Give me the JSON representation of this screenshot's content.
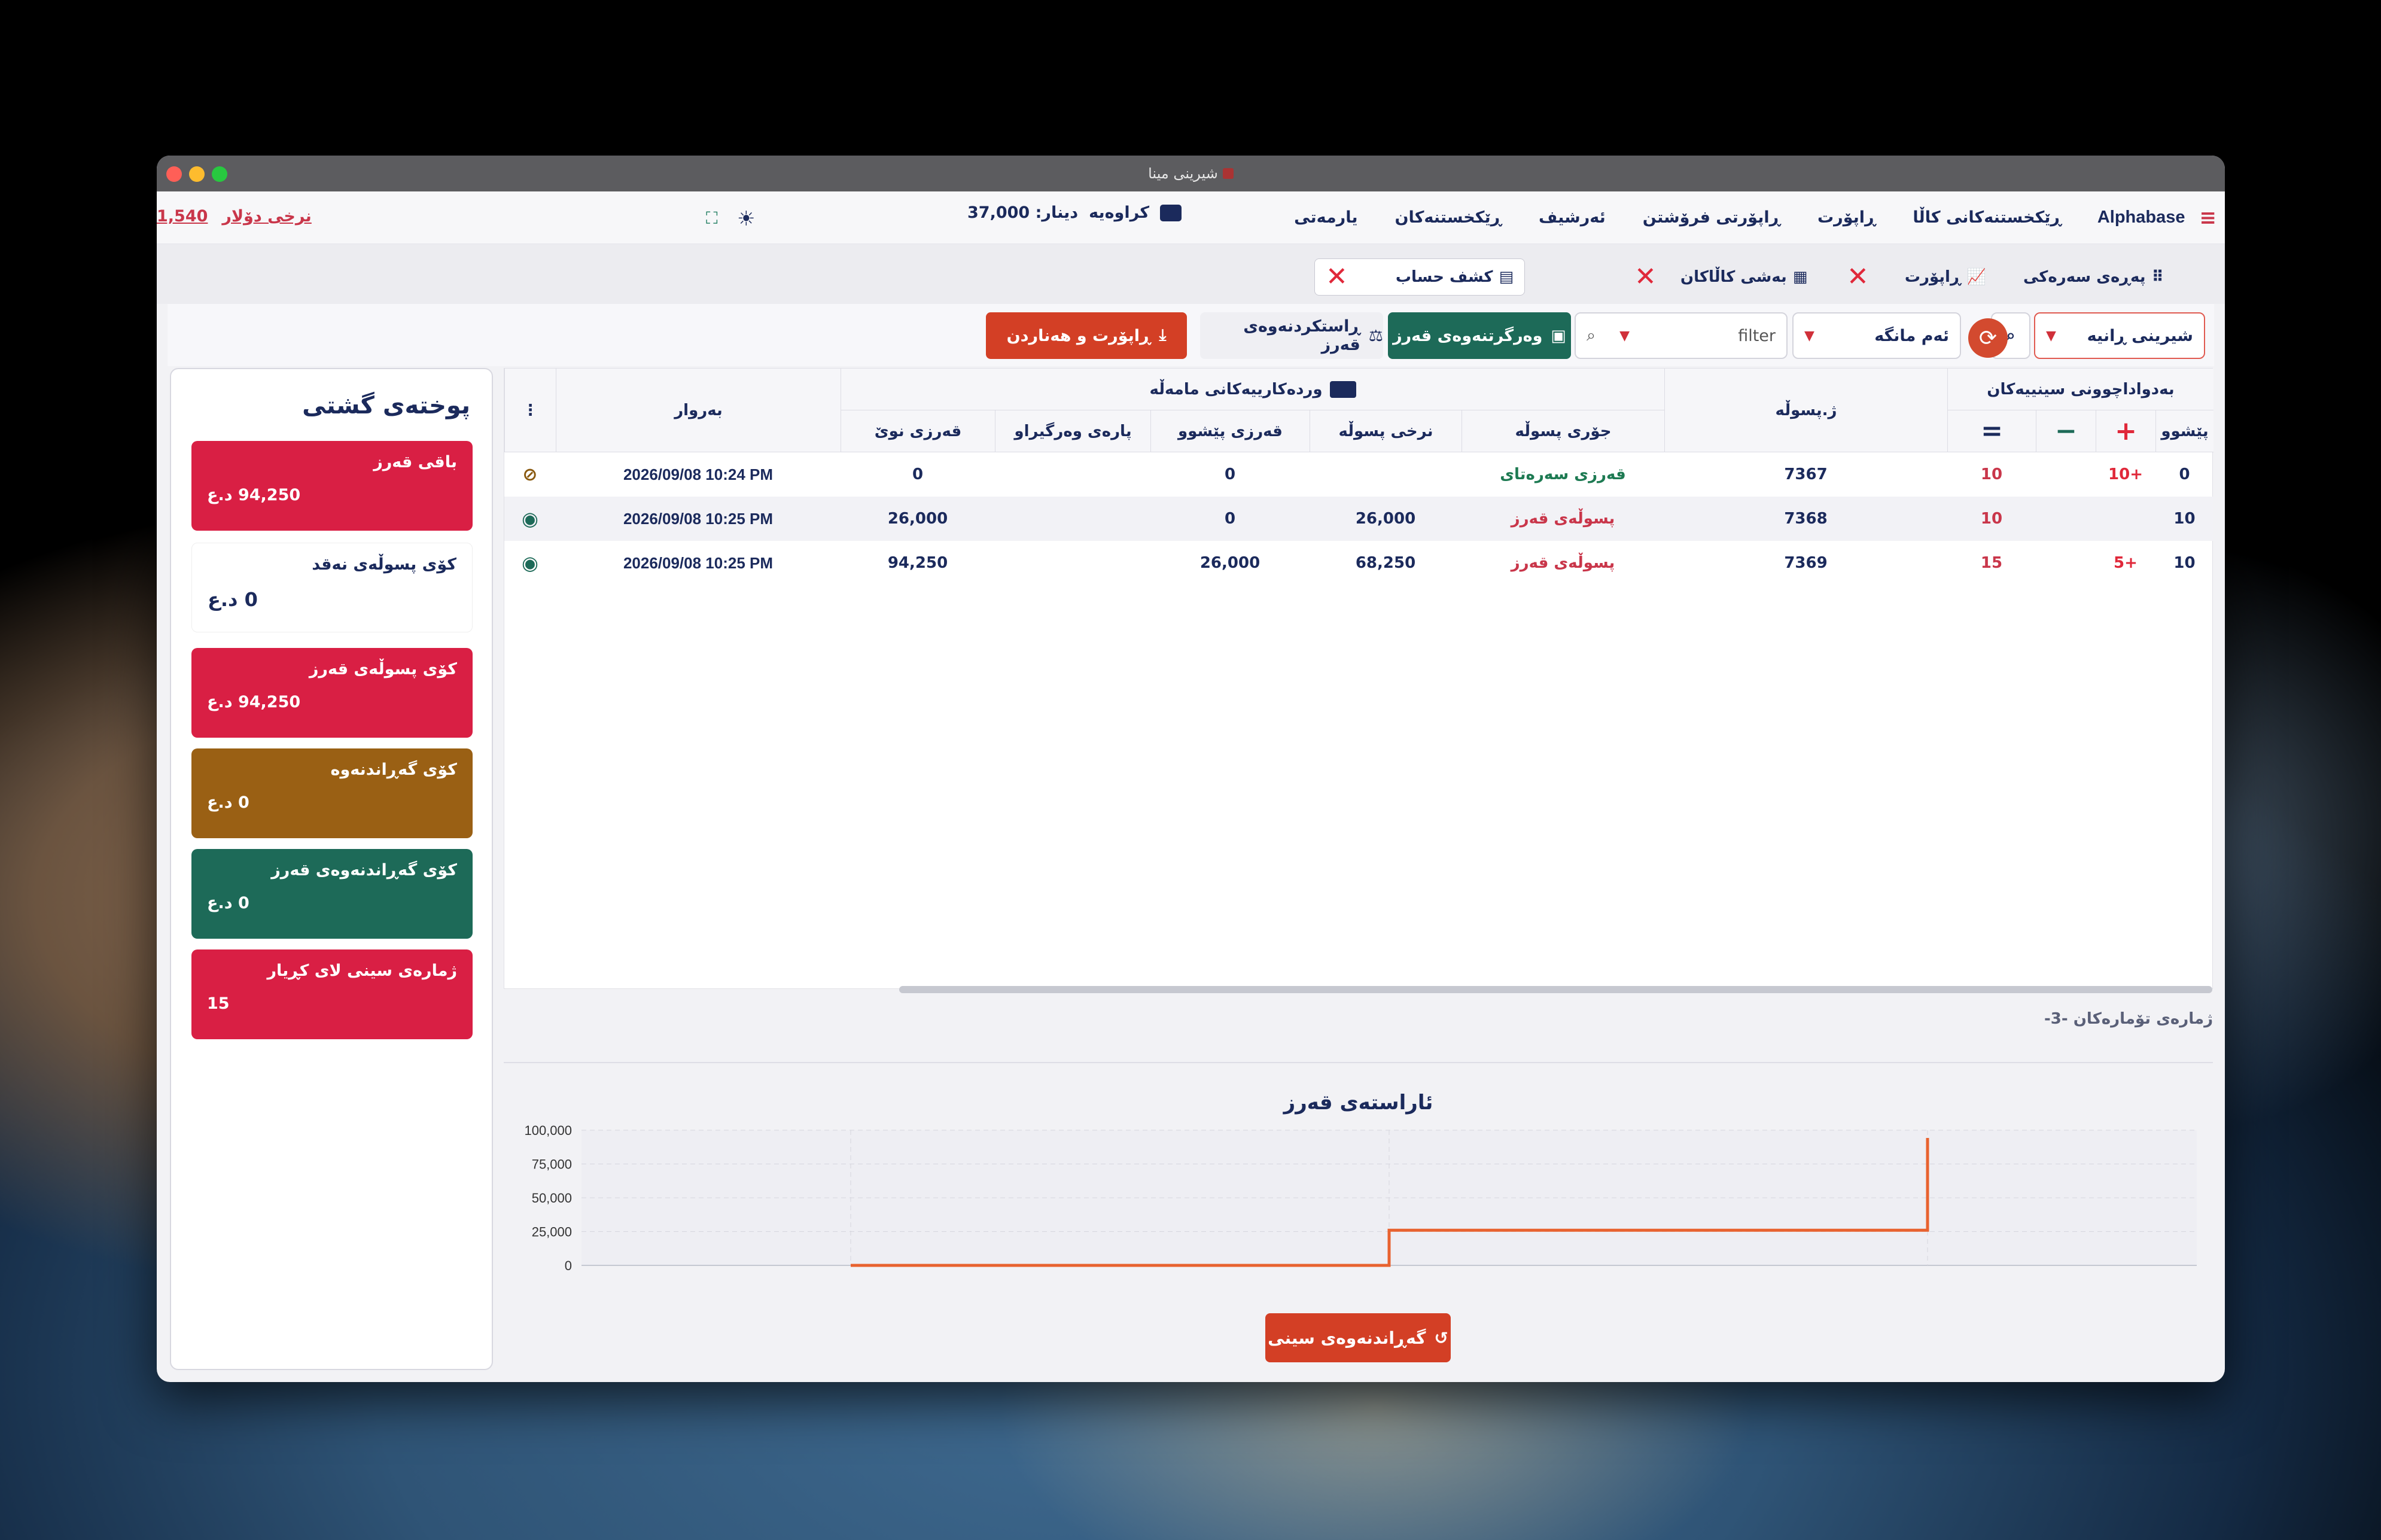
{
  "window": {
    "title": "شیرینی مینا"
  },
  "appbar": {
    "brand": "Alphabase",
    "menu": [
      "ڕێکخستنەکانی کاڵا",
      "ڕاپۆرت",
      "ڕاپۆرتی فرۆشتن",
      "ئەرشیف",
      "ڕێکخستنەکان",
      "یارمەتی"
    ],
    "cash_label": "کراوەیە",
    "cash_value": "دینار: 37,000",
    "rate_label": "نرخی دۆلار",
    "rate_value": "1,540"
  },
  "tabs": [
    {
      "label": "پەڕەی سەرەکی",
      "icon": "grid-icon"
    },
    {
      "label": "ڕاپۆرت",
      "icon": "chart-icon"
    },
    {
      "label": "بەشی کاڵاکان",
      "icon": "boxes-icon"
    },
    {
      "label": "کشف حساب",
      "icon": "document-icon",
      "active": true
    }
  ],
  "toolbar": {
    "customer_select": "شیرینی ڕانیە",
    "period_select": "ئەم مانگە",
    "filter_placeholder": "filter",
    "receive_debt_btn": "وەرگرتنەوەی قەرز",
    "correct_debt_btn": "ڕاستکردنەوەی قەرز",
    "export_btn": "ڕاپۆرت و هەناردن"
  },
  "summary": {
    "title": "پوختەی گشتی",
    "cards": [
      {
        "label": "باقی قەرز",
        "value": "94,250 د.ع",
        "color": "#d91f44"
      },
      {
        "label": "کۆی پسوڵەی نەقد",
        "value": "0 د.ع",
        "color": "#ffffff"
      },
      {
        "label": "کۆی پسوڵەی قەرز",
        "value": "94,250 د.ع",
        "color": "#d91f44"
      },
      {
        "label": "کۆی گەڕاندنەوە",
        "value": "0 د.ع",
        "color": "#9a6014"
      },
      {
        "label": "کۆی گەڕاندنەوەی قەرز",
        "value": "0 د.ع",
        "color": "#1d6a58"
      },
      {
        "label": "ژمارەی سینی لای کڕیار",
        "value": "15",
        "color": "#d91f44"
      }
    ]
  },
  "table": {
    "group_tray": "بەدواداچوونی سینییەکان",
    "group_details": "وردەکارییەکانی مامەڵە",
    "col_receipt_no": "ژ.پسوڵە",
    "col_date": "بەروار",
    "tray_cols": [
      "پێشوو",
      "+",
      "−",
      "="
    ],
    "detail_cols": [
      "جۆری پسوڵە",
      "نرخی پسوڵە",
      "قەرزی پێشوو",
      "پارەی وەرگیراو",
      "قەرزی نوێ"
    ],
    "rows": [
      {
        "prev": "0",
        "plus": "10+",
        "minus": "",
        "eq": "10",
        "no": "7367",
        "type": "قەرزی سەرەتای",
        "type_color": "#1d7a52",
        "price": "",
        "prev_debt": "0",
        "paid": "",
        "new_debt": "0",
        "date": "2026/09/08 10:24 PM",
        "eye": "eye-off-icon"
      },
      {
        "prev": "10",
        "plus": "",
        "minus": "",
        "eq": "10",
        "no": "7368",
        "type": "پسوڵەی قەرز",
        "type_color": "#c9364a",
        "price": "26,000",
        "prev_debt": "0",
        "paid": "",
        "new_debt": "26,000",
        "date": "2026/09/08 10:25 PM",
        "eye": "eye-icon"
      },
      {
        "prev": "10",
        "plus": "5+",
        "minus": "",
        "eq": "15",
        "no": "7369",
        "type": "پسوڵەی قەرز",
        "type_color": "#c9364a",
        "price": "68,250",
        "prev_debt": "26,000",
        "paid": "",
        "new_debt": "94,250",
        "date": "2026/09/08 10:25 PM",
        "eye": "eye-icon"
      }
    ],
    "footer_count": "ژمارەی تۆمارەکان -3-"
  },
  "chart_data": {
    "type": "line",
    "title": "ئاراستەی قەرز",
    "y_ticks": [
      "100,000",
      "75,000",
      "50,000",
      "25,000",
      "0"
    ],
    "ylim": [
      0,
      100000
    ],
    "x": [
      0,
      1,
      2
    ],
    "values": [
      0,
      26000,
      94250
    ],
    "color": "#e8622f",
    "grid": true
  },
  "undo_button": "گەڕاندنەوەی سینی"
}
